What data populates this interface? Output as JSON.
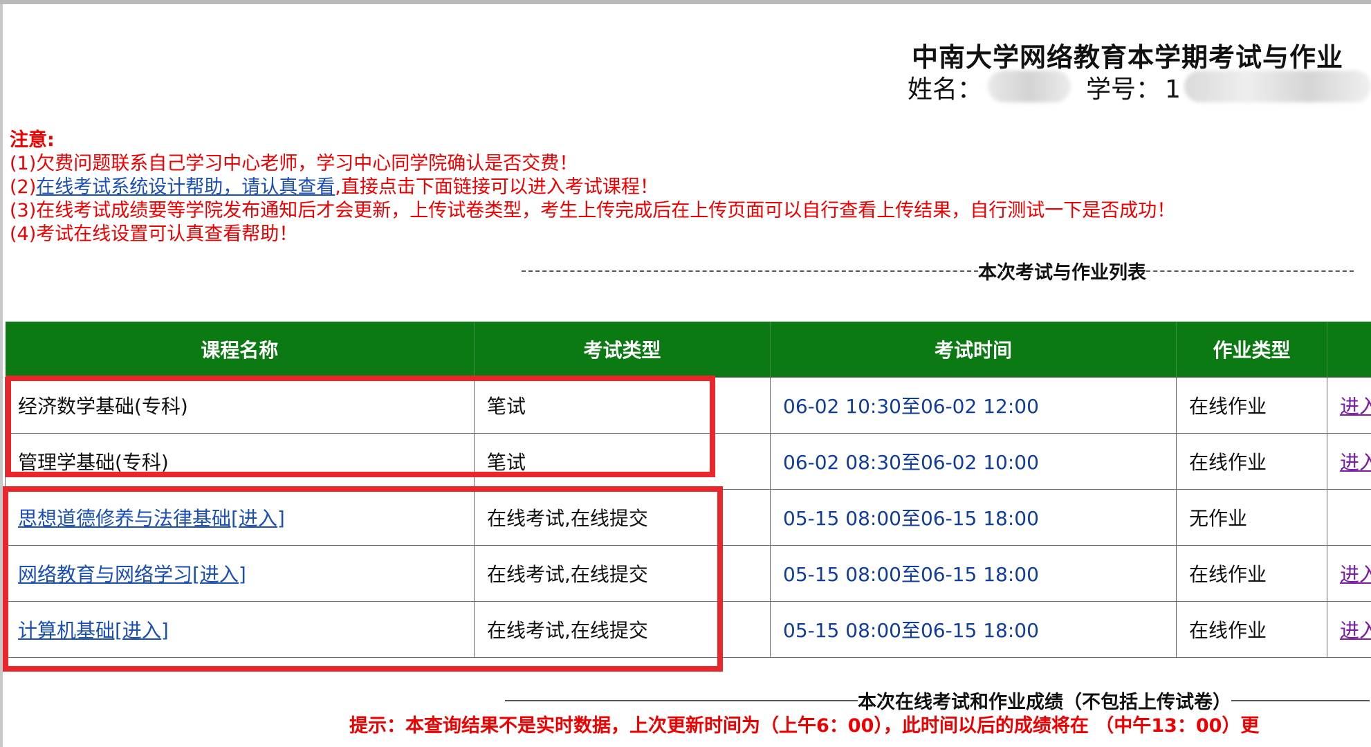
{
  "header": {
    "title": "中南大学网络教育本学期考试与作业",
    "name_label": "姓名：",
    "id_label": "学号：",
    "id_visible_prefix": "1"
  },
  "notice": {
    "title": "注意:",
    "items": [
      "(1)欠费问题联系自己学习中心老师，学习中心同学院确认是否交费！",
      "在线考试系统设计帮助，请认真查看",
      ",直接点击下面链接可以进入考试课程！",
      "(3)在线考试成绩要等学院发布通知后才会更新，上传试卷类型，考生上传完成后在上传页面可以自行查看上传结果，自行测试一下是否成功！",
      "(4)考试在线设置可认真查看帮助！"
    ],
    "item2_prefix": "(2)"
  },
  "list_section": {
    "title": "本次考试与作业列表"
  },
  "table": {
    "headers": [
      "课程名称",
      "考试类型",
      "考试时间",
      "作业类型",
      ""
    ],
    "rows": [
      {
        "course": "经济数学基础(专科)",
        "course_link": false,
        "exam_type": "笔试",
        "time": "06-02 10:30至06-02 12:00",
        "homework": "在线作业",
        "action": "进入"
      },
      {
        "course": "管理学基础(专科)",
        "course_link": false,
        "exam_type": "笔试",
        "time": "06-02 08:30至06-02 10:00",
        "homework": "在线作业",
        "action": "进入"
      },
      {
        "course": "思想道德修养与法律基础[进入]",
        "course_link": true,
        "exam_type": "在线考试,在线提交",
        "time": "05-15 08:00至06-15 18:00",
        "homework": "无作业",
        "action": ""
      },
      {
        "course": "网络教育与网络学习[进入]",
        "course_link": true,
        "exam_type": "在线考试,在线提交",
        "time": "05-15 08:00至06-15 18:00",
        "homework": "在线作业",
        "action": "进入"
      },
      {
        "course": "计算机基础[进入]",
        "course_link": true,
        "exam_type": "在线考试,在线提交",
        "time": "05-15 08:00至06-15 18:00",
        "homework": "在线作业",
        "action": "进入"
      }
    ]
  },
  "score_section": {
    "title": "本次在线考试和作业成绩（不包括上传试卷）"
  },
  "tip": {
    "text": "提示：本查询结果不是实时数据，上次更新时间为（上午6：00），此时间以后的成绩将在 （中午13：00）更"
  },
  "colors": {
    "header_green": "#0c7a13",
    "notice_red": "#ee0000",
    "link_blue": "#1a4fb8",
    "highlight_red": "#e8262b"
  }
}
